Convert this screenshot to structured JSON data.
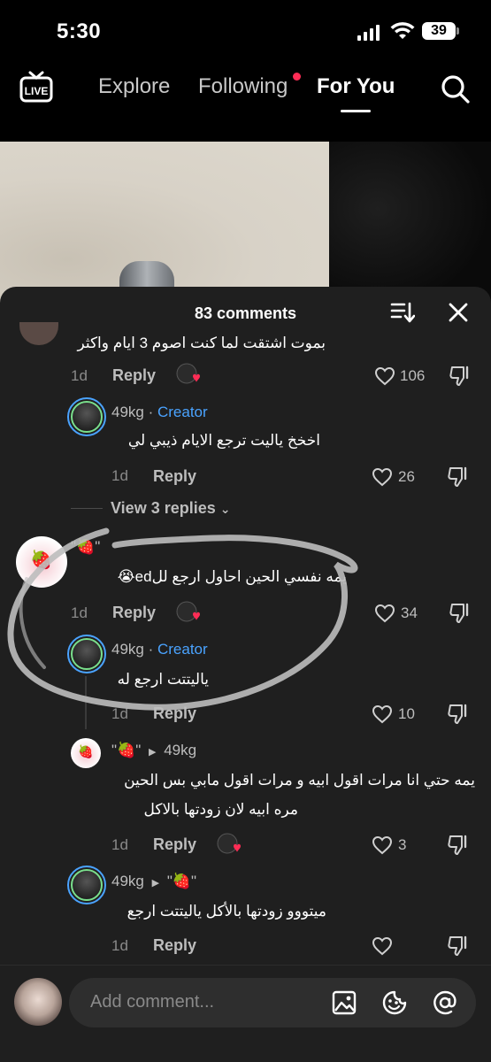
{
  "status_bar": {
    "time": "5:30",
    "battery": "39"
  },
  "nav": {
    "tabs": [
      {
        "label": "Explore"
      },
      {
        "label": "Following"
      },
      {
        "label": "For You"
      }
    ],
    "live_label": "LIVE"
  },
  "comments_sheet": {
    "title": "83 comments",
    "top_partial": {
      "text": "بموت اشتقت لما كنت اصوم 3 ايام واكثر",
      "age": "1d",
      "reply_label": "Reply",
      "likes": "106"
    },
    "reply1": {
      "username": "49kg",
      "creator_tag": "Creator",
      "text": "اخخخ ياليت ترجع الايام ذيبي لي",
      "age": "1d",
      "reply_label": "Reply",
      "likes": "26"
    },
    "view_replies": "View 3 replies",
    "comment2": {
      "username": "\"🍓\"",
      "text": "يمه نفسي الحين احاول ارجع للed😭",
      "age": "1d",
      "reply_label": "Reply",
      "likes": "34"
    },
    "reply2": {
      "username": "49kg",
      "creator_tag": "Creator",
      "text": "ياليتتت ارجع له",
      "age": "1d",
      "reply_label": "Reply",
      "likes": "10"
    },
    "reply3": {
      "username": "\"🍓\"",
      "to": "49kg",
      "line1": "يمه حتي انا مرات اقول ابيه و مرات اقول مابي بس الحين",
      "line2": "مره ابيه لان زودتها بالاكل",
      "age": "1d",
      "reply_label": "Reply",
      "likes": "3"
    },
    "reply4": {
      "username": "49kg",
      "to": "\"🍓\"",
      "text": "ميتووو زودتها بالأكل ياليتتت ارجع",
      "age": "1d",
      "reply_label": "Reply"
    }
  },
  "input": {
    "placeholder": "Add comment..."
  },
  "colors": {
    "creator": "#4aa3ff",
    "accent": "#fe2c55",
    "sheet": "#1f1f1f"
  }
}
